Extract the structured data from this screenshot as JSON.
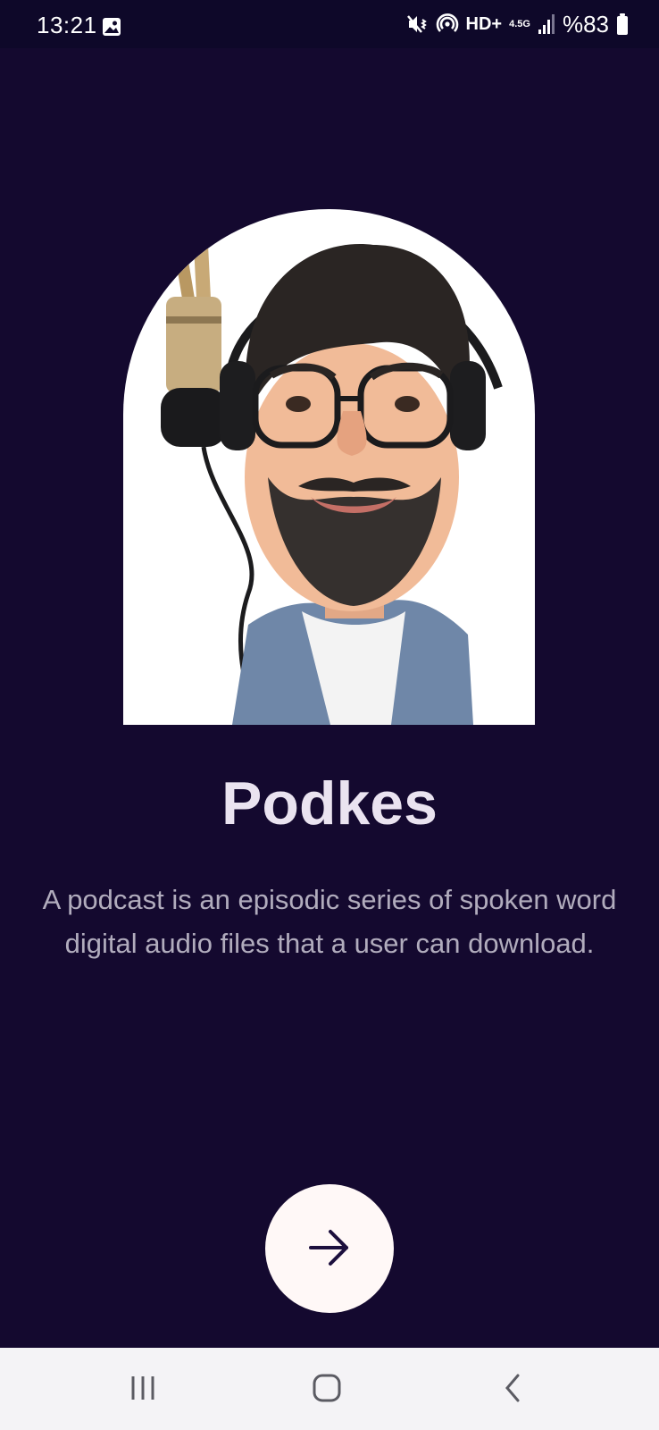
{
  "status_bar": {
    "time": "13:21",
    "network_label": "HD+",
    "network_type": "4.5G",
    "battery_percent": "%83",
    "icons": [
      "gallery-icon",
      "mute-vibrate-icon",
      "hotspot-icon",
      "signal-icon",
      "battery-icon"
    ]
  },
  "onboarding": {
    "title": "Podkes",
    "description": "A podcast is an episodic series of spoken word digital audio files that a user can download.",
    "next_icon": "arrow-right-icon"
  },
  "navigation_bar": {
    "icons": [
      "recent-apps-icon",
      "home-icon",
      "back-icon"
    ]
  },
  "colors": {
    "background": "#14092f",
    "status_bar": "#0e0829",
    "title": "#eae3f0",
    "description": "#b1acbd",
    "button_bg": "#fff8f7",
    "button_icon": "#1c0f3d",
    "nav_bar": "#f4f3f6"
  }
}
